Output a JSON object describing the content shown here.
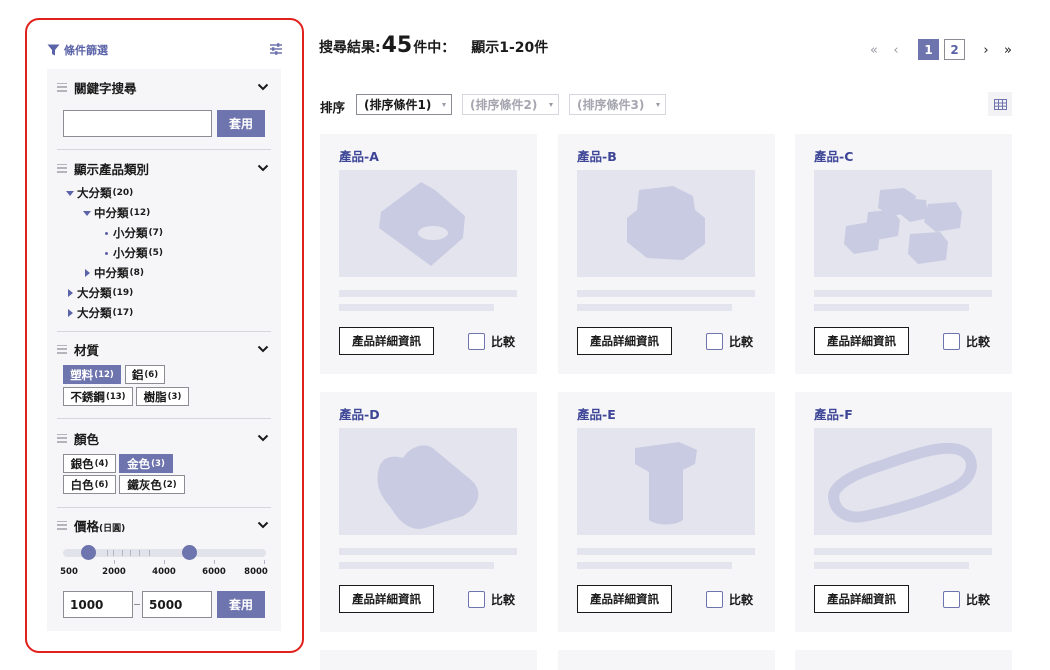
{
  "sidebar": {
    "title": "條件篩選",
    "sections": {
      "keyword": {
        "label": "關鍵字搜尋",
        "input_value": "",
        "apply_label": "套用"
      },
      "category": {
        "label": "顯示產品類別",
        "tree": [
          {
            "label": "大分類",
            "count": "(20)",
            "state": "open"
          },
          {
            "label": "中分類",
            "count": "(12)",
            "state": "open"
          },
          {
            "label": "小分類",
            "count": "(7)",
            "state": "leaf"
          },
          {
            "label": "小分類",
            "count": "(5)",
            "state": "leaf"
          },
          {
            "label": "中分類",
            "count": "(8)",
            "state": "closed"
          },
          {
            "label": "大分類",
            "count": "(19)",
            "state": "closed"
          },
          {
            "label": "大分類",
            "count": "(17)",
            "state": "closed"
          }
        ]
      },
      "material": {
        "label": "材質",
        "chips": [
          {
            "label": "塑料",
            "count": "(12)",
            "selected": true
          },
          {
            "label": "鋁",
            "count": "(6)",
            "selected": false
          },
          {
            "label": "不銹鋼",
            "count": "(13)",
            "selected": false
          },
          {
            "label": "樹脂",
            "count": "(3)",
            "selected": false
          }
        ]
      },
      "color": {
        "label": "顏色",
        "chips": [
          {
            "label": "銀色",
            "count": "(4)",
            "selected": false
          },
          {
            "label": "金色",
            "count": "(3)",
            "selected": true
          },
          {
            "label": "白色",
            "count": "(6)",
            "selected": false
          },
          {
            "label": "鐵灰色",
            "count": "(2)",
            "selected": false
          }
        ]
      },
      "price": {
        "label": "價格",
        "unit": "(日圓)",
        "axis_labels": [
          "500",
          "2000",
          "4000",
          "6000",
          "8000"
        ],
        "min_value": "1000",
        "max_value": "5000",
        "apply_label": "套用"
      }
    }
  },
  "results": {
    "label": "搜尋結果:",
    "count": "45",
    "unit": "件中：",
    "range": "顯示1-20件"
  },
  "pagination": {
    "first": "«",
    "prev": "‹",
    "pages": [
      "1",
      "2"
    ],
    "current": "1",
    "next": "›",
    "last": "»"
  },
  "sort": {
    "label": "排序",
    "options": [
      "(排序條件1)",
      "(排序條件2)",
      "(排序條件3)"
    ]
  },
  "products": [
    {
      "name": "產品-A",
      "detail_label": "產品詳細資訊",
      "compare_label": "比較",
      "image": "angled-plate-with-hole"
    },
    {
      "name": "產品-B",
      "detail_label": "產品詳細資訊",
      "compare_label": "比較",
      "image": "cylinder-block"
    },
    {
      "name": "產品-C",
      "detail_label": "產品詳細資訊",
      "compare_label": "比較",
      "image": "hex-nuts"
    },
    {
      "name": "產品-D",
      "detail_label": "產品詳細資訊",
      "compare_label": "比較",
      "image": "irregular-plate"
    },
    {
      "name": "產品-E",
      "detail_label": "產品詳細資訊",
      "compare_label": "比較",
      "image": "t-shaped-pin"
    },
    {
      "name": "產品-F",
      "detail_label": "產品詳細資訊",
      "compare_label": "比較",
      "image": "rubber-band-ring"
    }
  ],
  "colors": {
    "accent": "#6e74ad",
    "product_name": "#3d4596",
    "sidebar_outline": "#e0211c",
    "placeholder": "#e4e4ee"
  }
}
